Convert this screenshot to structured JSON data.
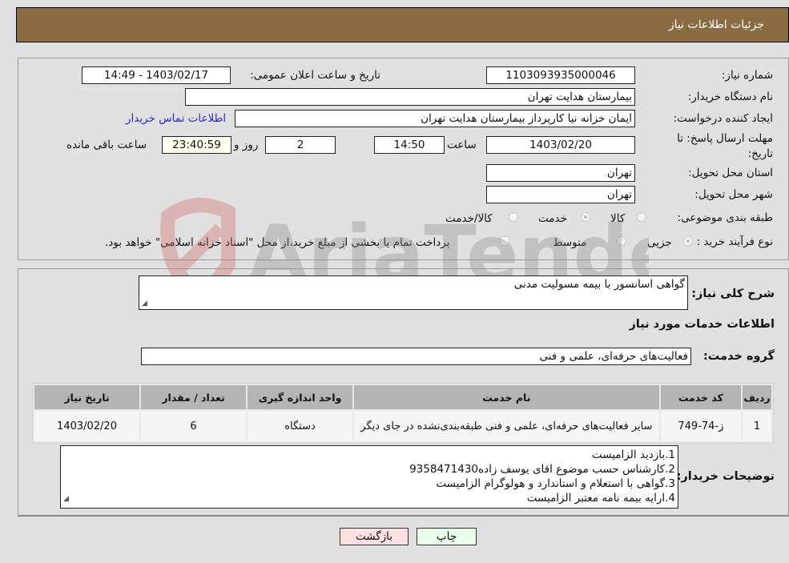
{
  "header": {
    "title": "جزئیات اطلاعات نیاز"
  },
  "form": {
    "need_number": {
      "label": "شماره نیاز:",
      "value": "1103093935000046"
    },
    "announce_datetime": {
      "label": "تاریخ و ساعت اعلان عمومی:",
      "value": "1403/02/17 - 14:49"
    },
    "buyer_org": {
      "label": "نام دستگاه خریدار:",
      "value": "بیمارستان هدایت تهران"
    },
    "creator": {
      "label": "ایجاد کننده درخواست:",
      "value": "ایمان خزانه نیا کارپرداز بیمارستان هدایت تهران"
    },
    "contact_link": "اطلاعات تماس خریدار",
    "deadline": {
      "label": "مهلت ارسال پاسخ: تا تاریخ:",
      "date": "1403/02/20",
      "time_label": "ساعت",
      "time": "14:50",
      "days": "2",
      "days_label": "روز و",
      "remaining": "23:40:59",
      "remaining_label": "ساعت باقی مانده"
    },
    "province": {
      "label": "استان محل تحویل:",
      "value": "تهران"
    },
    "city": {
      "label": "شهر محل تحویل:",
      "value": "تهران"
    },
    "category": {
      "label": "طبقه بندی موضوعی:",
      "options": [
        "کالا",
        "خدمت",
        "کالا/خدمت"
      ],
      "selected": "خدمت"
    },
    "purchase_process": {
      "label": "نوع فرآیند خرید :",
      "options": [
        "جزیی",
        "متوسط"
      ],
      "selected": "جزیی",
      "treasury_note": "پرداخت تمام یا بخشی از مبلغ خرید،از محل \"اسناد خزانه اسلامی\" خواهد بود."
    }
  },
  "details": {
    "summary_label": "شرح کلی نیاز:",
    "summary_value": "گواهی اسانسور با بیمه مسولیت مدنی",
    "services_heading": "اطلاعات خدمات مورد نیاز",
    "service_group_label": "گروه خدمت:",
    "service_group_value": "فعالیت‌های حرفه‌ای، علمی و فنی",
    "table": {
      "headers": [
        "ردیف",
        "کد خدمت",
        "نام خدمت",
        "واحد اندازه گیری",
        "تعداد / مقدار",
        "تاریخ نیاز"
      ],
      "rows": [
        [
          "1",
          "ز-74-749",
          "سایر فعالیت‌های حرفه‌ای، علمی و فنی طبقه‌بندی‌نشده در جای دیگر",
          "دستگاه",
          "6",
          "1403/02/20"
        ]
      ]
    },
    "buyer_notes_label": "توضیحات خریدار:",
    "buyer_notes": [
      "1.بازدید الزامیست",
      "2.کارشناس حسب موضوع اقای یوسف زاده9358471430",
      "3.گواهی با استعلام و استاندارد و هولوگرام الزامیست",
      "4.ارایه بیمه نامه معتبر الزامیست"
    ]
  },
  "buttons": {
    "print": "چاپ",
    "back": "بازگشت"
  },
  "watermark": "AriaTender.neT",
  "colors": {
    "header": "#8b6c42",
    "print_bg": "#eaffea",
    "back_bg": "#ffe0e0",
    "link": "#2a2ad6"
  }
}
